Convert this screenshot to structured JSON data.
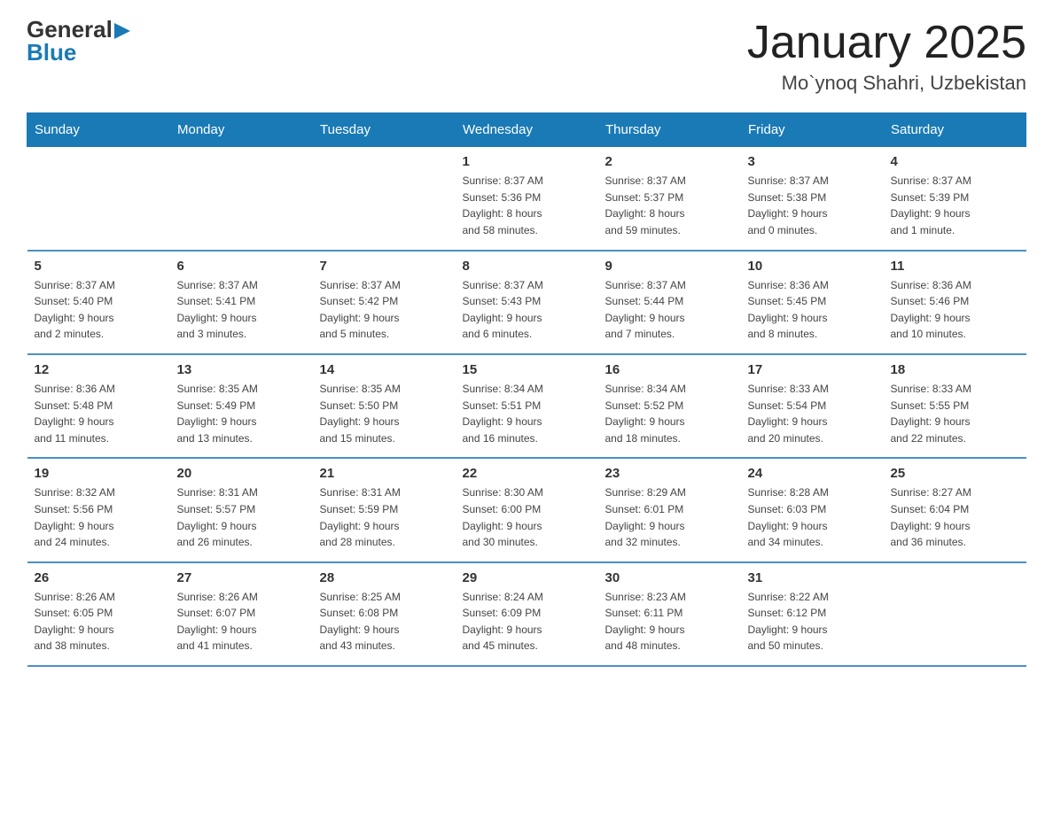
{
  "logo": {
    "general": "General",
    "blue": "Blue"
  },
  "header": {
    "month": "January 2025",
    "location": "Mo`ynoq Shahri, Uzbekistan"
  },
  "weekdays": [
    "Sunday",
    "Monday",
    "Tuesday",
    "Wednesday",
    "Thursday",
    "Friday",
    "Saturday"
  ],
  "weeks": [
    [
      {
        "day": "",
        "info": ""
      },
      {
        "day": "",
        "info": ""
      },
      {
        "day": "",
        "info": ""
      },
      {
        "day": "1",
        "info": "Sunrise: 8:37 AM\nSunset: 5:36 PM\nDaylight: 8 hours\nand 58 minutes."
      },
      {
        "day": "2",
        "info": "Sunrise: 8:37 AM\nSunset: 5:37 PM\nDaylight: 8 hours\nand 59 minutes."
      },
      {
        "day": "3",
        "info": "Sunrise: 8:37 AM\nSunset: 5:38 PM\nDaylight: 9 hours\nand 0 minutes."
      },
      {
        "day": "4",
        "info": "Sunrise: 8:37 AM\nSunset: 5:39 PM\nDaylight: 9 hours\nand 1 minute."
      }
    ],
    [
      {
        "day": "5",
        "info": "Sunrise: 8:37 AM\nSunset: 5:40 PM\nDaylight: 9 hours\nand 2 minutes."
      },
      {
        "day": "6",
        "info": "Sunrise: 8:37 AM\nSunset: 5:41 PM\nDaylight: 9 hours\nand 3 minutes."
      },
      {
        "day": "7",
        "info": "Sunrise: 8:37 AM\nSunset: 5:42 PM\nDaylight: 9 hours\nand 5 minutes."
      },
      {
        "day": "8",
        "info": "Sunrise: 8:37 AM\nSunset: 5:43 PM\nDaylight: 9 hours\nand 6 minutes."
      },
      {
        "day": "9",
        "info": "Sunrise: 8:37 AM\nSunset: 5:44 PM\nDaylight: 9 hours\nand 7 minutes."
      },
      {
        "day": "10",
        "info": "Sunrise: 8:36 AM\nSunset: 5:45 PM\nDaylight: 9 hours\nand 8 minutes."
      },
      {
        "day": "11",
        "info": "Sunrise: 8:36 AM\nSunset: 5:46 PM\nDaylight: 9 hours\nand 10 minutes."
      }
    ],
    [
      {
        "day": "12",
        "info": "Sunrise: 8:36 AM\nSunset: 5:48 PM\nDaylight: 9 hours\nand 11 minutes."
      },
      {
        "day": "13",
        "info": "Sunrise: 8:35 AM\nSunset: 5:49 PM\nDaylight: 9 hours\nand 13 minutes."
      },
      {
        "day": "14",
        "info": "Sunrise: 8:35 AM\nSunset: 5:50 PM\nDaylight: 9 hours\nand 15 minutes."
      },
      {
        "day": "15",
        "info": "Sunrise: 8:34 AM\nSunset: 5:51 PM\nDaylight: 9 hours\nand 16 minutes."
      },
      {
        "day": "16",
        "info": "Sunrise: 8:34 AM\nSunset: 5:52 PM\nDaylight: 9 hours\nand 18 minutes."
      },
      {
        "day": "17",
        "info": "Sunrise: 8:33 AM\nSunset: 5:54 PM\nDaylight: 9 hours\nand 20 minutes."
      },
      {
        "day": "18",
        "info": "Sunrise: 8:33 AM\nSunset: 5:55 PM\nDaylight: 9 hours\nand 22 minutes."
      }
    ],
    [
      {
        "day": "19",
        "info": "Sunrise: 8:32 AM\nSunset: 5:56 PM\nDaylight: 9 hours\nand 24 minutes."
      },
      {
        "day": "20",
        "info": "Sunrise: 8:31 AM\nSunset: 5:57 PM\nDaylight: 9 hours\nand 26 minutes."
      },
      {
        "day": "21",
        "info": "Sunrise: 8:31 AM\nSunset: 5:59 PM\nDaylight: 9 hours\nand 28 minutes."
      },
      {
        "day": "22",
        "info": "Sunrise: 8:30 AM\nSunset: 6:00 PM\nDaylight: 9 hours\nand 30 minutes."
      },
      {
        "day": "23",
        "info": "Sunrise: 8:29 AM\nSunset: 6:01 PM\nDaylight: 9 hours\nand 32 minutes."
      },
      {
        "day": "24",
        "info": "Sunrise: 8:28 AM\nSunset: 6:03 PM\nDaylight: 9 hours\nand 34 minutes."
      },
      {
        "day": "25",
        "info": "Sunrise: 8:27 AM\nSunset: 6:04 PM\nDaylight: 9 hours\nand 36 minutes."
      }
    ],
    [
      {
        "day": "26",
        "info": "Sunrise: 8:26 AM\nSunset: 6:05 PM\nDaylight: 9 hours\nand 38 minutes."
      },
      {
        "day": "27",
        "info": "Sunrise: 8:26 AM\nSunset: 6:07 PM\nDaylight: 9 hours\nand 41 minutes."
      },
      {
        "day": "28",
        "info": "Sunrise: 8:25 AM\nSunset: 6:08 PM\nDaylight: 9 hours\nand 43 minutes."
      },
      {
        "day": "29",
        "info": "Sunrise: 8:24 AM\nSunset: 6:09 PM\nDaylight: 9 hours\nand 45 minutes."
      },
      {
        "day": "30",
        "info": "Sunrise: 8:23 AM\nSunset: 6:11 PM\nDaylight: 9 hours\nand 48 minutes."
      },
      {
        "day": "31",
        "info": "Sunrise: 8:22 AM\nSunset: 6:12 PM\nDaylight: 9 hours\nand 50 minutes."
      },
      {
        "day": "",
        "info": ""
      }
    ]
  ]
}
